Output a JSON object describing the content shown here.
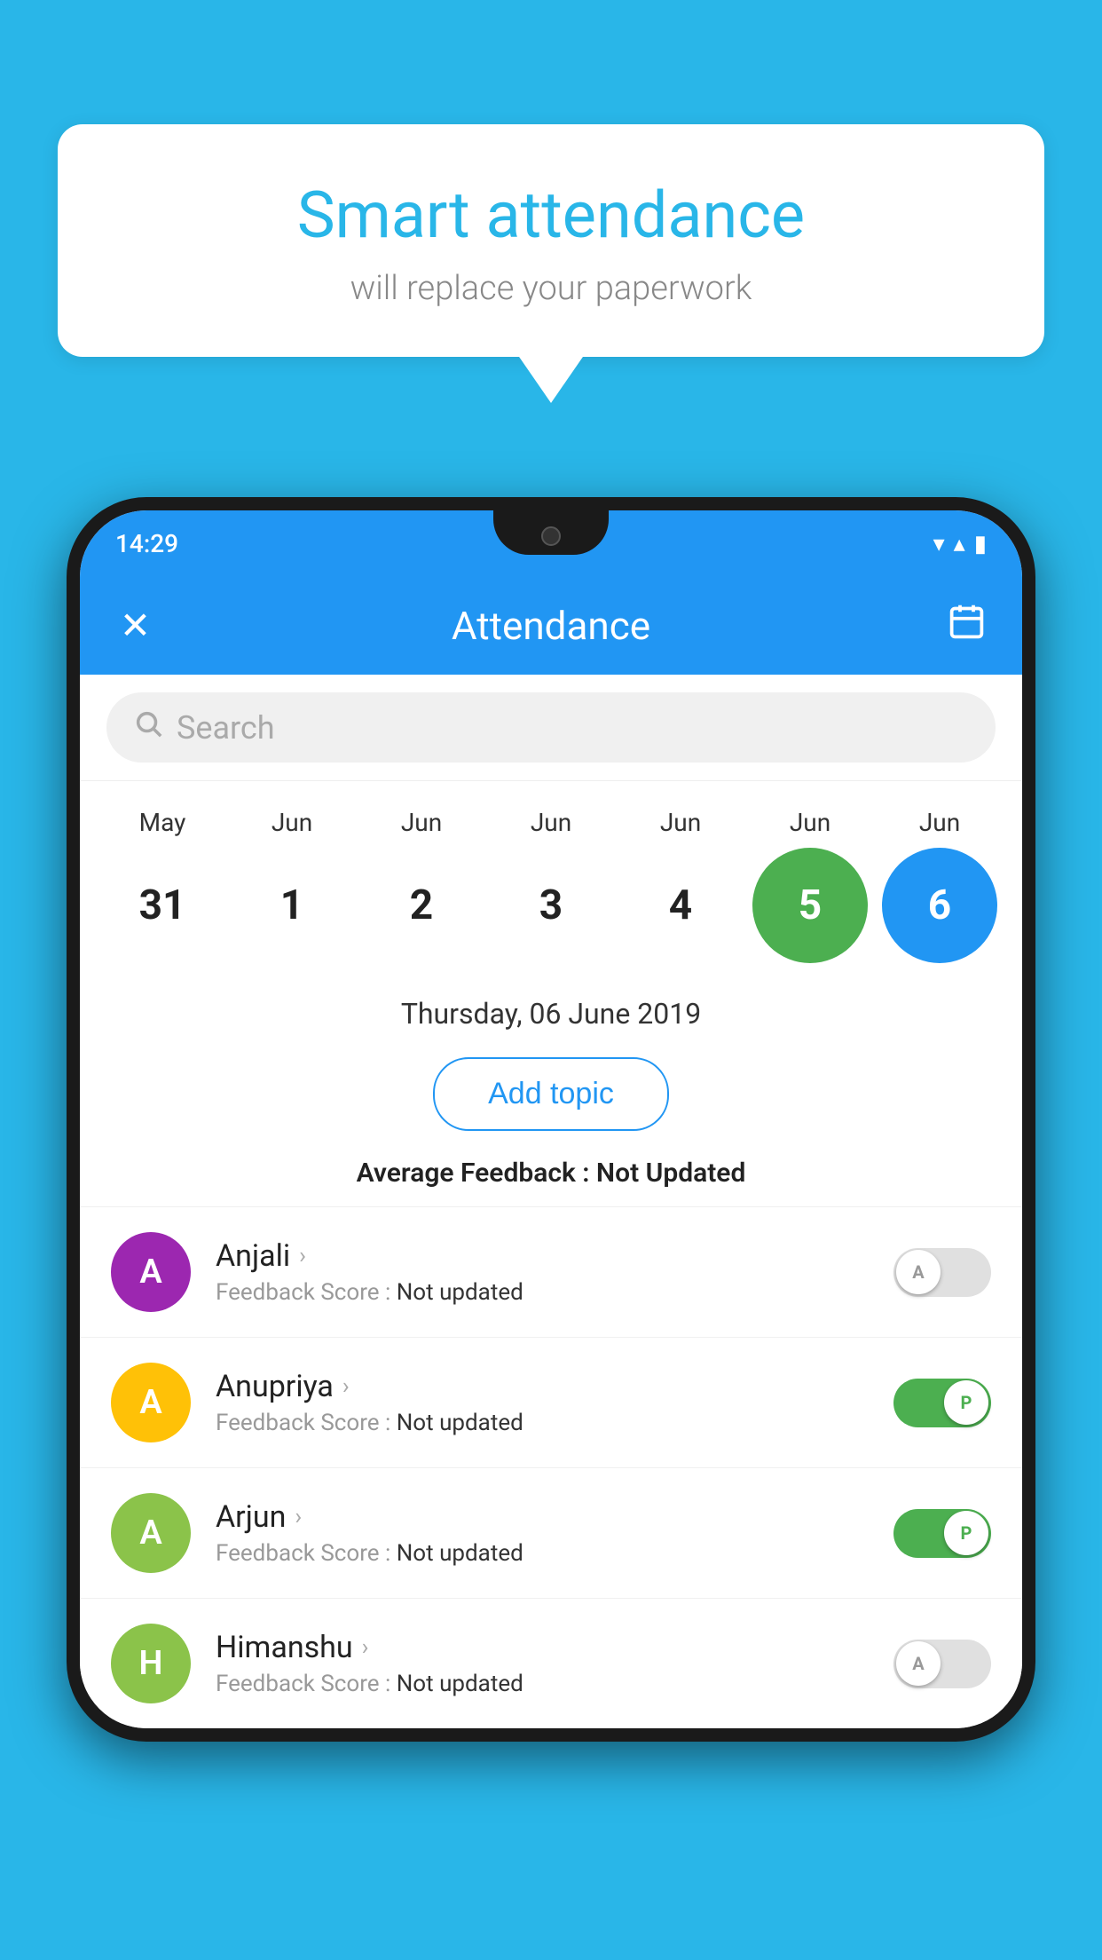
{
  "background_color": "#29b6e8",
  "speech_bubble": {
    "title": "Smart attendance",
    "subtitle": "will replace your paperwork"
  },
  "status_bar": {
    "time": "14:29",
    "wifi": "▾",
    "signal": "▴",
    "battery": "▮"
  },
  "app_bar": {
    "title": "Attendance",
    "close_icon": "✕",
    "calendar_icon": "📅"
  },
  "search": {
    "placeholder": "Search"
  },
  "calendar": {
    "columns": [
      {
        "month": "May",
        "date": "31",
        "state": "normal"
      },
      {
        "month": "Jun",
        "date": "1",
        "state": "normal"
      },
      {
        "month": "Jun",
        "date": "2",
        "state": "normal"
      },
      {
        "month": "Jun",
        "date": "3",
        "state": "normal"
      },
      {
        "month": "Jun",
        "date": "4",
        "state": "normal"
      },
      {
        "month": "Jun",
        "date": "5",
        "state": "today"
      },
      {
        "month": "Jun",
        "date": "6",
        "state": "selected"
      }
    ]
  },
  "selected_date": "Thursday, 06 June 2019",
  "add_topic_label": "Add topic",
  "average_feedback": {
    "label": "Average Feedback : ",
    "value": "Not Updated"
  },
  "students": [
    {
      "name": "Anjali",
      "avatar_letter": "A",
      "avatar_color": "#9c27b0",
      "feedback_label": "Feedback Score : ",
      "feedback_value": "Not updated",
      "toggle_state": "off",
      "toggle_label": "A"
    },
    {
      "name": "Anupriya",
      "avatar_letter": "A",
      "avatar_color": "#ffc107",
      "feedback_label": "Feedback Score : ",
      "feedback_value": "Not updated",
      "toggle_state": "on",
      "toggle_label": "P"
    },
    {
      "name": "Arjun",
      "avatar_letter": "A",
      "avatar_color": "#8bc34a",
      "feedback_label": "Feedback Score : ",
      "feedback_value": "Not updated",
      "toggle_state": "on",
      "toggle_label": "P"
    },
    {
      "name": "Himanshu",
      "avatar_letter": "H",
      "avatar_color": "#8bc34a",
      "feedback_label": "Feedback Score : ",
      "feedback_value": "Not updated",
      "toggle_state": "off",
      "toggle_label": "A"
    }
  ]
}
